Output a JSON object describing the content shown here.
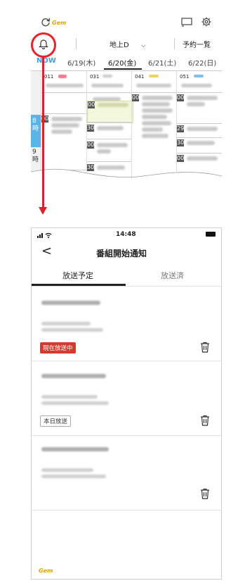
{
  "top_screenshot": {
    "logo": "Gem",
    "toolbar": {
      "channel_select_label": "地上D",
      "channel_select_chevron": "⌵",
      "reservation_list_label": "予約一覧"
    },
    "date_tabs": [
      "NOW",
      "6/19(木)",
      "6/20(金)",
      "6/21(土)",
      "6/22(日)"
    ],
    "selected_date_index": 2,
    "channels": [
      "011",
      "031",
      "041",
      "051"
    ],
    "hour_labels": [
      {
        "hour": "8",
        "unit": "時"
      },
      {
        "hour": "9",
        "unit": "時"
      }
    ],
    "slot_minutes": [
      "00",
      "00",
      "00",
      "00",
      "30",
      "30",
      "30",
      "29",
      "00",
      "00"
    ],
    "colors": {
      "now_tab": "#3aa0e6",
      "hour_highlight": "#5bb4e8",
      "selected_program": "#f3f7dc"
    }
  },
  "annotation": {
    "color": "#e02128",
    "target": "bell-icon"
  },
  "phone": {
    "status_bar": {
      "time": "14:48"
    },
    "nav": {
      "back_label": "<",
      "title": "番組開始通知"
    },
    "tabs": [
      {
        "label": "放送予定",
        "active": true
      },
      {
        "label": "放送済",
        "active": false
      }
    ],
    "notifications": [
      {
        "badge": "現在放送中",
        "badge_style": "red"
      },
      {
        "badge": "本日放送",
        "badge_style": "outline"
      },
      {
        "badge": "",
        "badge_style": "none"
      }
    ],
    "footer_logo": "Gem"
  }
}
